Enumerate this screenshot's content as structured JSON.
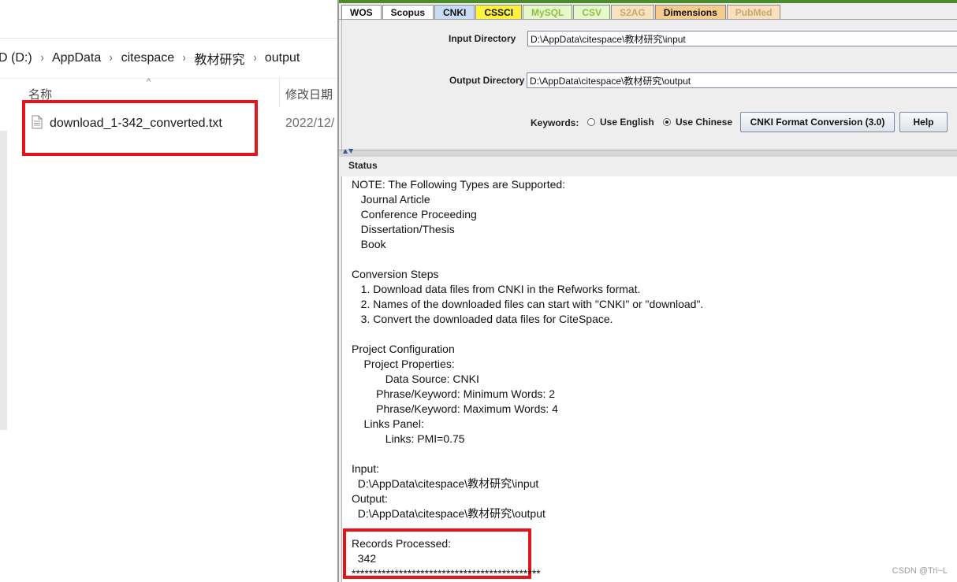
{
  "explorer": {
    "breadcrumb": [
      "D (D:)",
      "AppData",
      "citespace",
      "教材研究",
      "output"
    ],
    "breadcrumb_separator": "›",
    "columns": {
      "name": "名称",
      "date": "修改日期"
    },
    "file": {
      "name": "download_1-342_converted.txt",
      "date": "2022/12/"
    }
  },
  "app": {
    "tabs": [
      {
        "label": "WOS",
        "bg": "#ffffff",
        "color": "#111111"
      },
      {
        "label": "Scopus",
        "bg": "#ffffff",
        "color": "#111111"
      },
      {
        "label": "CNKI",
        "bg": "#c9dcf5",
        "color": "#111111"
      },
      {
        "label": "CSSCI",
        "bg": "#fff23d",
        "color": "#111111"
      },
      {
        "label": "MySQL",
        "bg": "#e6f7c9",
        "color": "#8cbf4c"
      },
      {
        "label": "CSV",
        "bg": "#e6f7c9",
        "color": "#8cbf4c"
      },
      {
        "label": "S2AG",
        "bg": "#f5e2c0",
        "color": "#c9a86d"
      },
      {
        "label": "Dimensions",
        "bg": "#f5cb8e",
        "color": "#111111"
      },
      {
        "label": "PubMed",
        "bg": "#f7dfc0",
        "color": "#c9a86d"
      }
    ],
    "input_dir": {
      "label": "Input Directory",
      "value": "D:\\AppData\\citespace\\教材研究\\input"
    },
    "output_dir": {
      "label": "Output Directory",
      "value": "D:\\AppData\\citespace\\教材研究\\output"
    },
    "keywords_label": "Keywords:",
    "radio_english": "Use English",
    "radio_chinese": "Use Chinese",
    "convert_button": "CNKI Format Conversion (3.0)",
    "help_button": "Help",
    "status_title": "Status",
    "status_lines": [
      "NOTE: The Following Types are Supported:",
      "   Journal Article",
      "   Conference Proceeding",
      "   Dissertation/Thesis",
      "   Book",
      "",
      "Conversion Steps",
      "   1. Download data files from CNKI in the Refworks format.",
      "   2. Names of the downloaded files can start with \"CNKI\" or \"download\".",
      "   3. Convert the downloaded data files for CiteSpace.",
      "",
      "Project Configuration",
      "    Project Properties:",
      "           Data Source: CNKI",
      "        Phrase/Keyword: Minimum Words: 2",
      "        Phrase/Keyword: Maximum Words: 4",
      "    Links Panel:",
      "           Links: PMI=0.75",
      "",
      "Input:",
      "  D:\\AppData\\citespace\\教材研究\\input",
      "Output:",
      "  D:\\AppData\\citespace\\教材研究\\output",
      "",
      "Records Processed:",
      "  342",
      "********************************************"
    ]
  },
  "watermark": "CSDN @Tri~L"
}
